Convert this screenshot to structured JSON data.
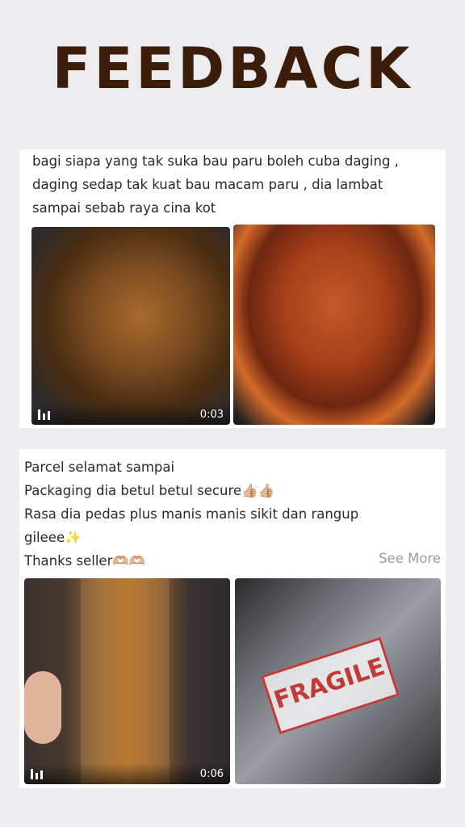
{
  "page": {
    "title": "FEEDBACK"
  },
  "reviews": [
    {
      "lines": [
        "bagi siapa yang tak suka bau paru boleh cuba daging ,",
        "daging sedap tak kuat bau macam paru , dia lambat",
        "sampai sebab raya cina kot"
      ],
      "media": [
        {
          "type": "video",
          "icon": "video-bars-icon",
          "duration": "0:03"
        },
        {
          "type": "image"
        }
      ]
    },
    {
      "lines": [
        "Parcel selamat sampai",
        "Packaging dia betul betul secure👍🏼👍🏼",
        "Rasa dia pedas plus manis manis sikit dan rangup",
        "gileee✨",
        "Thanks seller🫶🏼🫶🏼"
      ],
      "see_more": "See More",
      "media": [
        {
          "type": "video",
          "icon": "video-bars-icon",
          "duration": "0:06"
        },
        {
          "type": "image",
          "label": "FRAGILE"
        }
      ]
    }
  ],
  "colors": {
    "title": "#3b1d0a",
    "background": "#ececee",
    "card": "#ffffff",
    "see_more": "#9a9a9a"
  }
}
